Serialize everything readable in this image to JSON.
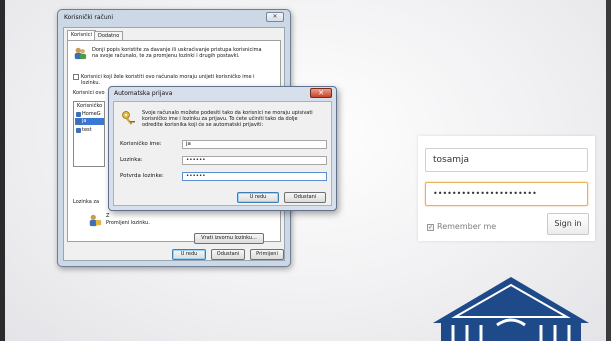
{
  "user_accounts_dialog": {
    "title": "Korisnički računi",
    "close_glyph": "✕",
    "tabs": [
      "Korisnici",
      "Dodatno"
    ],
    "intro_line1": "Donji popis koristite za davanje ili uskraćivanje pristupa korisnicima",
    "intro_line2": "na svoje računalo, te za promjenu lozinki i drugih postavki.",
    "must_enter_line1": "Korisnici koji žele koristiti ovo računalo moraju unijeti korisničko ime i",
    "must_enter_line2": "lozinku.",
    "users_header_partial": "Korisnici ovo",
    "list_header_partial": "Korisničko",
    "users": [
      "HomeG",
      "ja",
      "test"
    ],
    "selected_user_index": 1,
    "password_section_partial": "Lozinka za",
    "change_pw_line1": "Z",
    "change_pw_line2": "Promijeni lozinku.",
    "reset_password_button": "Vrati izvornu lozinku...",
    "ok_button": "U redu",
    "cancel_button": "Odustani",
    "apply_button": "Primijeni"
  },
  "auto_logon_dialog": {
    "title": "Automatska prijava",
    "close_glyph": "✕",
    "description_line1": "Svoje računalo možete podesiti tako da korisnici ne moraju upisivati",
    "description_line2": "korisničko ime i lozinku za prijavu. To ćete učiniti tako da dolje",
    "description_line3": "odredite korisnika koji će se automatski prijaviti:",
    "username_label": "Korisničko ime:",
    "username_value": "ja",
    "password_label": "Lozinka:",
    "password_value": "••••••",
    "confirm_label": "Potvrda lozinke:",
    "confirm_value": "••••••",
    "ok_button": "U redu",
    "cancel_button": "Odustani"
  },
  "signin_form": {
    "username_value": "tosamja",
    "password_value": "••••••••••••••••••••••",
    "remember_label": "Remember me",
    "remember_checked": true,
    "signin_button": "Sign in",
    "focus_color": "#e6b25a",
    "check_color": "#3b6aa5"
  },
  "colors": {
    "selection_blue": "#3a78d4",
    "logo_blue": "#1f4a8a",
    "close_red": "#c6442a"
  }
}
